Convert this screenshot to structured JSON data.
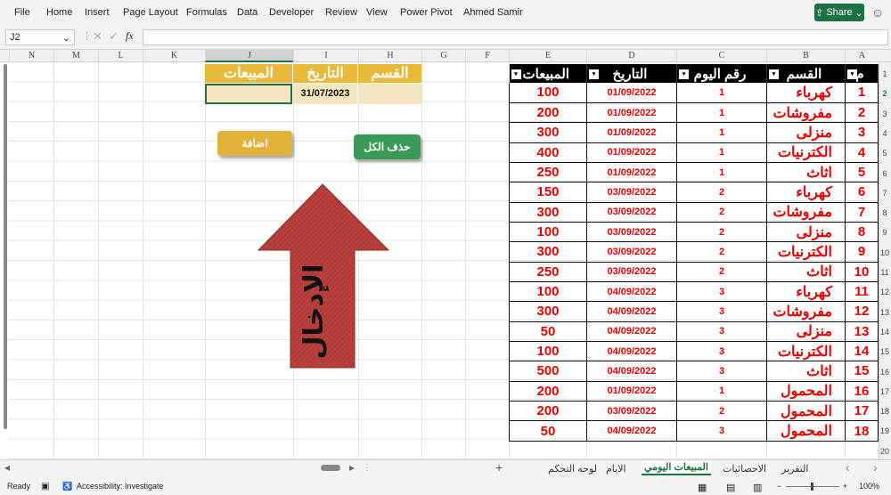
{
  "menu": {
    "items": [
      "File",
      "Home",
      "Insert",
      "Page Layout",
      "Formulas",
      "Data",
      "Developer",
      "Review",
      "View",
      "Power Pivot",
      "Ahmed Samir"
    ],
    "share_label": "Share"
  },
  "formula_bar": {
    "name_box": "J2",
    "fx_label": "fx",
    "value": ""
  },
  "columns": [
    "N",
    "M",
    "L",
    "K",
    "J",
    "I",
    "H",
    "G",
    "F",
    "E",
    "D",
    "C",
    "B",
    "A"
  ],
  "rows": [
    "1",
    "2",
    "3",
    "4",
    "5",
    "6",
    "7",
    "8",
    "9",
    "10",
    "11",
    "12",
    "13",
    "14",
    "15",
    "16",
    "17",
    "18",
    "19",
    "20"
  ],
  "table": {
    "headers": [
      "المبيعات",
      "التاريخ",
      "رقم اليوم",
      "القسم",
      "م"
    ],
    "rows": [
      [
        "100",
        "01/09/2022",
        "1",
        "كهرباء",
        "1"
      ],
      [
        "200",
        "01/09/2022",
        "1",
        "مفروشات",
        "2"
      ],
      [
        "300",
        "01/09/2022",
        "1",
        "منزلى",
        "3"
      ],
      [
        "400",
        "01/09/2022",
        "1",
        "الكترنيات",
        "4"
      ],
      [
        "250",
        "01/09/2022",
        "1",
        "اثاث",
        "5"
      ],
      [
        "150",
        "03/09/2022",
        "2",
        "كهرباء",
        "6"
      ],
      [
        "300",
        "03/09/2022",
        "2",
        "مفروشات",
        "7"
      ],
      [
        "100",
        "03/09/2022",
        "2",
        "منزلى",
        "8"
      ],
      [
        "300",
        "03/09/2022",
        "2",
        "الكترنيات",
        "9"
      ],
      [
        "250",
        "03/09/2022",
        "2",
        "اثاث",
        "10"
      ],
      [
        "100",
        "04/09/2022",
        "3",
        "كهرباء",
        "11"
      ],
      [
        "300",
        "04/09/2022",
        "3",
        "مفروشات",
        "12"
      ],
      [
        "50",
        "04/09/2022",
        "3",
        "منزلى",
        "13"
      ],
      [
        "100",
        "04/09/2022",
        "3",
        "الكترنيات",
        "14"
      ],
      [
        "500",
        "04/09/2022",
        "3",
        "اثاث",
        "15"
      ],
      [
        "200",
        "01/09/2022",
        "1",
        "المحمول",
        "16"
      ],
      [
        "200",
        "03/09/2022",
        "2",
        "المحمول",
        "17"
      ],
      [
        "50",
        "04/09/2022",
        "3",
        "المحمول",
        "18"
      ]
    ]
  },
  "input_form": {
    "header_sales": "المبيعات",
    "header_date": "التاريخ",
    "header_category": "القسم",
    "date_value": "31/07/2023",
    "add_button": "اضافة",
    "clear_button": "حذف الكل",
    "arrow_text": "الإدخال"
  },
  "colors": {
    "header_bg": "#000000",
    "value_text": "#e00000",
    "input_header": "#e8b93b",
    "add_button": "#e0b23a",
    "clear_button": "#3a9a57",
    "arrow": "#b9403b"
  },
  "sheet_tabs": {
    "items": [
      "التقرير",
      "الاحصائيات",
      "المبيعات اليومي",
      "الايام",
      "لوحه التحكم"
    ],
    "active": "المبيعات اليومي",
    "add_label": "+"
  },
  "status": {
    "ready": "Ready",
    "accessibility": "Accessibility: Investigate",
    "zoom": "100%"
  }
}
